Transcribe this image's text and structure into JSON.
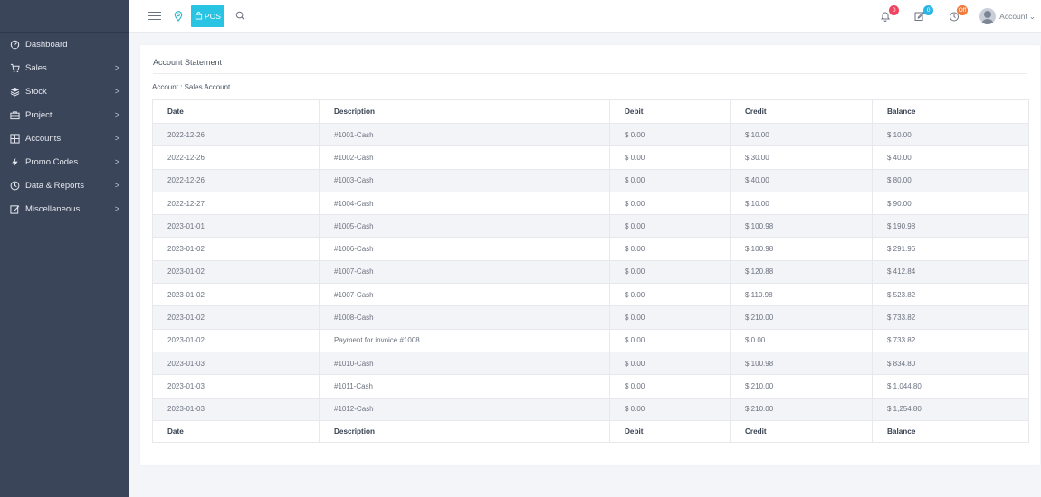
{
  "sidebar": {
    "items": [
      {
        "label": "Dashboard",
        "icon": "dashboard-icon",
        "has_arrow": false
      },
      {
        "label": "Sales",
        "icon": "cart-icon",
        "has_arrow": true
      },
      {
        "label": "Stock",
        "icon": "stack-icon",
        "has_arrow": true
      },
      {
        "label": "Project",
        "icon": "briefcase-icon",
        "has_arrow": true
      },
      {
        "label": "Accounts",
        "icon": "ledger-icon",
        "has_arrow": true
      },
      {
        "label": "Promo Codes",
        "icon": "flash-icon",
        "has_arrow": true
      },
      {
        "label": "Data & Reports",
        "icon": "clock-icon",
        "has_arrow": true
      },
      {
        "label": "Miscellaneous",
        "icon": "edit-icon",
        "has_arrow": true
      }
    ],
    "arrow": ">"
  },
  "topbar": {
    "pos_label": "POS",
    "badges": {
      "notifications": "0",
      "messages": "0",
      "clock": "Off"
    },
    "account_label": "Account",
    "account_caret": "⌄"
  },
  "colors": {
    "sidebar": "#3b4559",
    "accent": "#29c3e3",
    "badge_red": "#ef4561",
    "badge_blue": "#29b6e6",
    "badge_orange": "#f07b3f"
  },
  "page": {
    "title": "Account Statement",
    "account_line": "Account : Sales Account"
  },
  "table": {
    "headers": [
      "Date",
      "Description",
      "Debit",
      "Credit",
      "Balance"
    ],
    "rows": [
      [
        "2022-12-26",
        "#1001-Cash",
        "$ 0.00",
        "$ 10.00",
        "$ 10.00"
      ],
      [
        "2022-12-26",
        "#1002-Cash",
        "$ 0.00",
        "$ 30.00",
        "$ 40.00"
      ],
      [
        "2022-12-26",
        "#1003-Cash",
        "$ 0.00",
        "$ 40.00",
        "$ 80.00"
      ],
      [
        "2022-12-27",
        "#1004-Cash",
        "$ 0.00",
        "$ 10.00",
        "$ 90.00"
      ],
      [
        "2023-01-01",
        "#1005-Cash",
        "$ 0.00",
        "$ 100.98",
        "$ 190.98"
      ],
      [
        "2023-01-02",
        "#1006-Cash",
        "$ 0.00",
        "$ 100.98",
        "$ 291.96"
      ],
      [
        "2023-01-02",
        "#1007-Cash",
        "$ 0.00",
        "$ 120.88",
        "$ 412.84"
      ],
      [
        "2023-01-02",
        "#1007-Cash",
        "$ 0.00",
        "$ 110.98",
        "$ 523.82"
      ],
      [
        "2023-01-02",
        "#1008-Cash",
        "$ 0.00",
        "$ 210.00",
        "$ 733.82"
      ],
      [
        "2023-01-02",
        "Payment for invoice #1008",
        "$ 0.00",
        "$ 0.00",
        "$ 733.82"
      ],
      [
        "2023-01-03",
        "#1010-Cash",
        "$ 0.00",
        "$ 100.98",
        "$ 834.80"
      ],
      [
        "2023-01-03",
        "#1011-Cash",
        "$ 0.00",
        "$ 210.00",
        "$ 1,044.80"
      ],
      [
        "2023-01-03",
        "#1012-Cash",
        "$ 0.00",
        "$ 210.00",
        "$ 1,254.80"
      ]
    ],
    "footer": [
      "Date",
      "Description",
      "Debit",
      "Credit",
      "Balance"
    ]
  }
}
